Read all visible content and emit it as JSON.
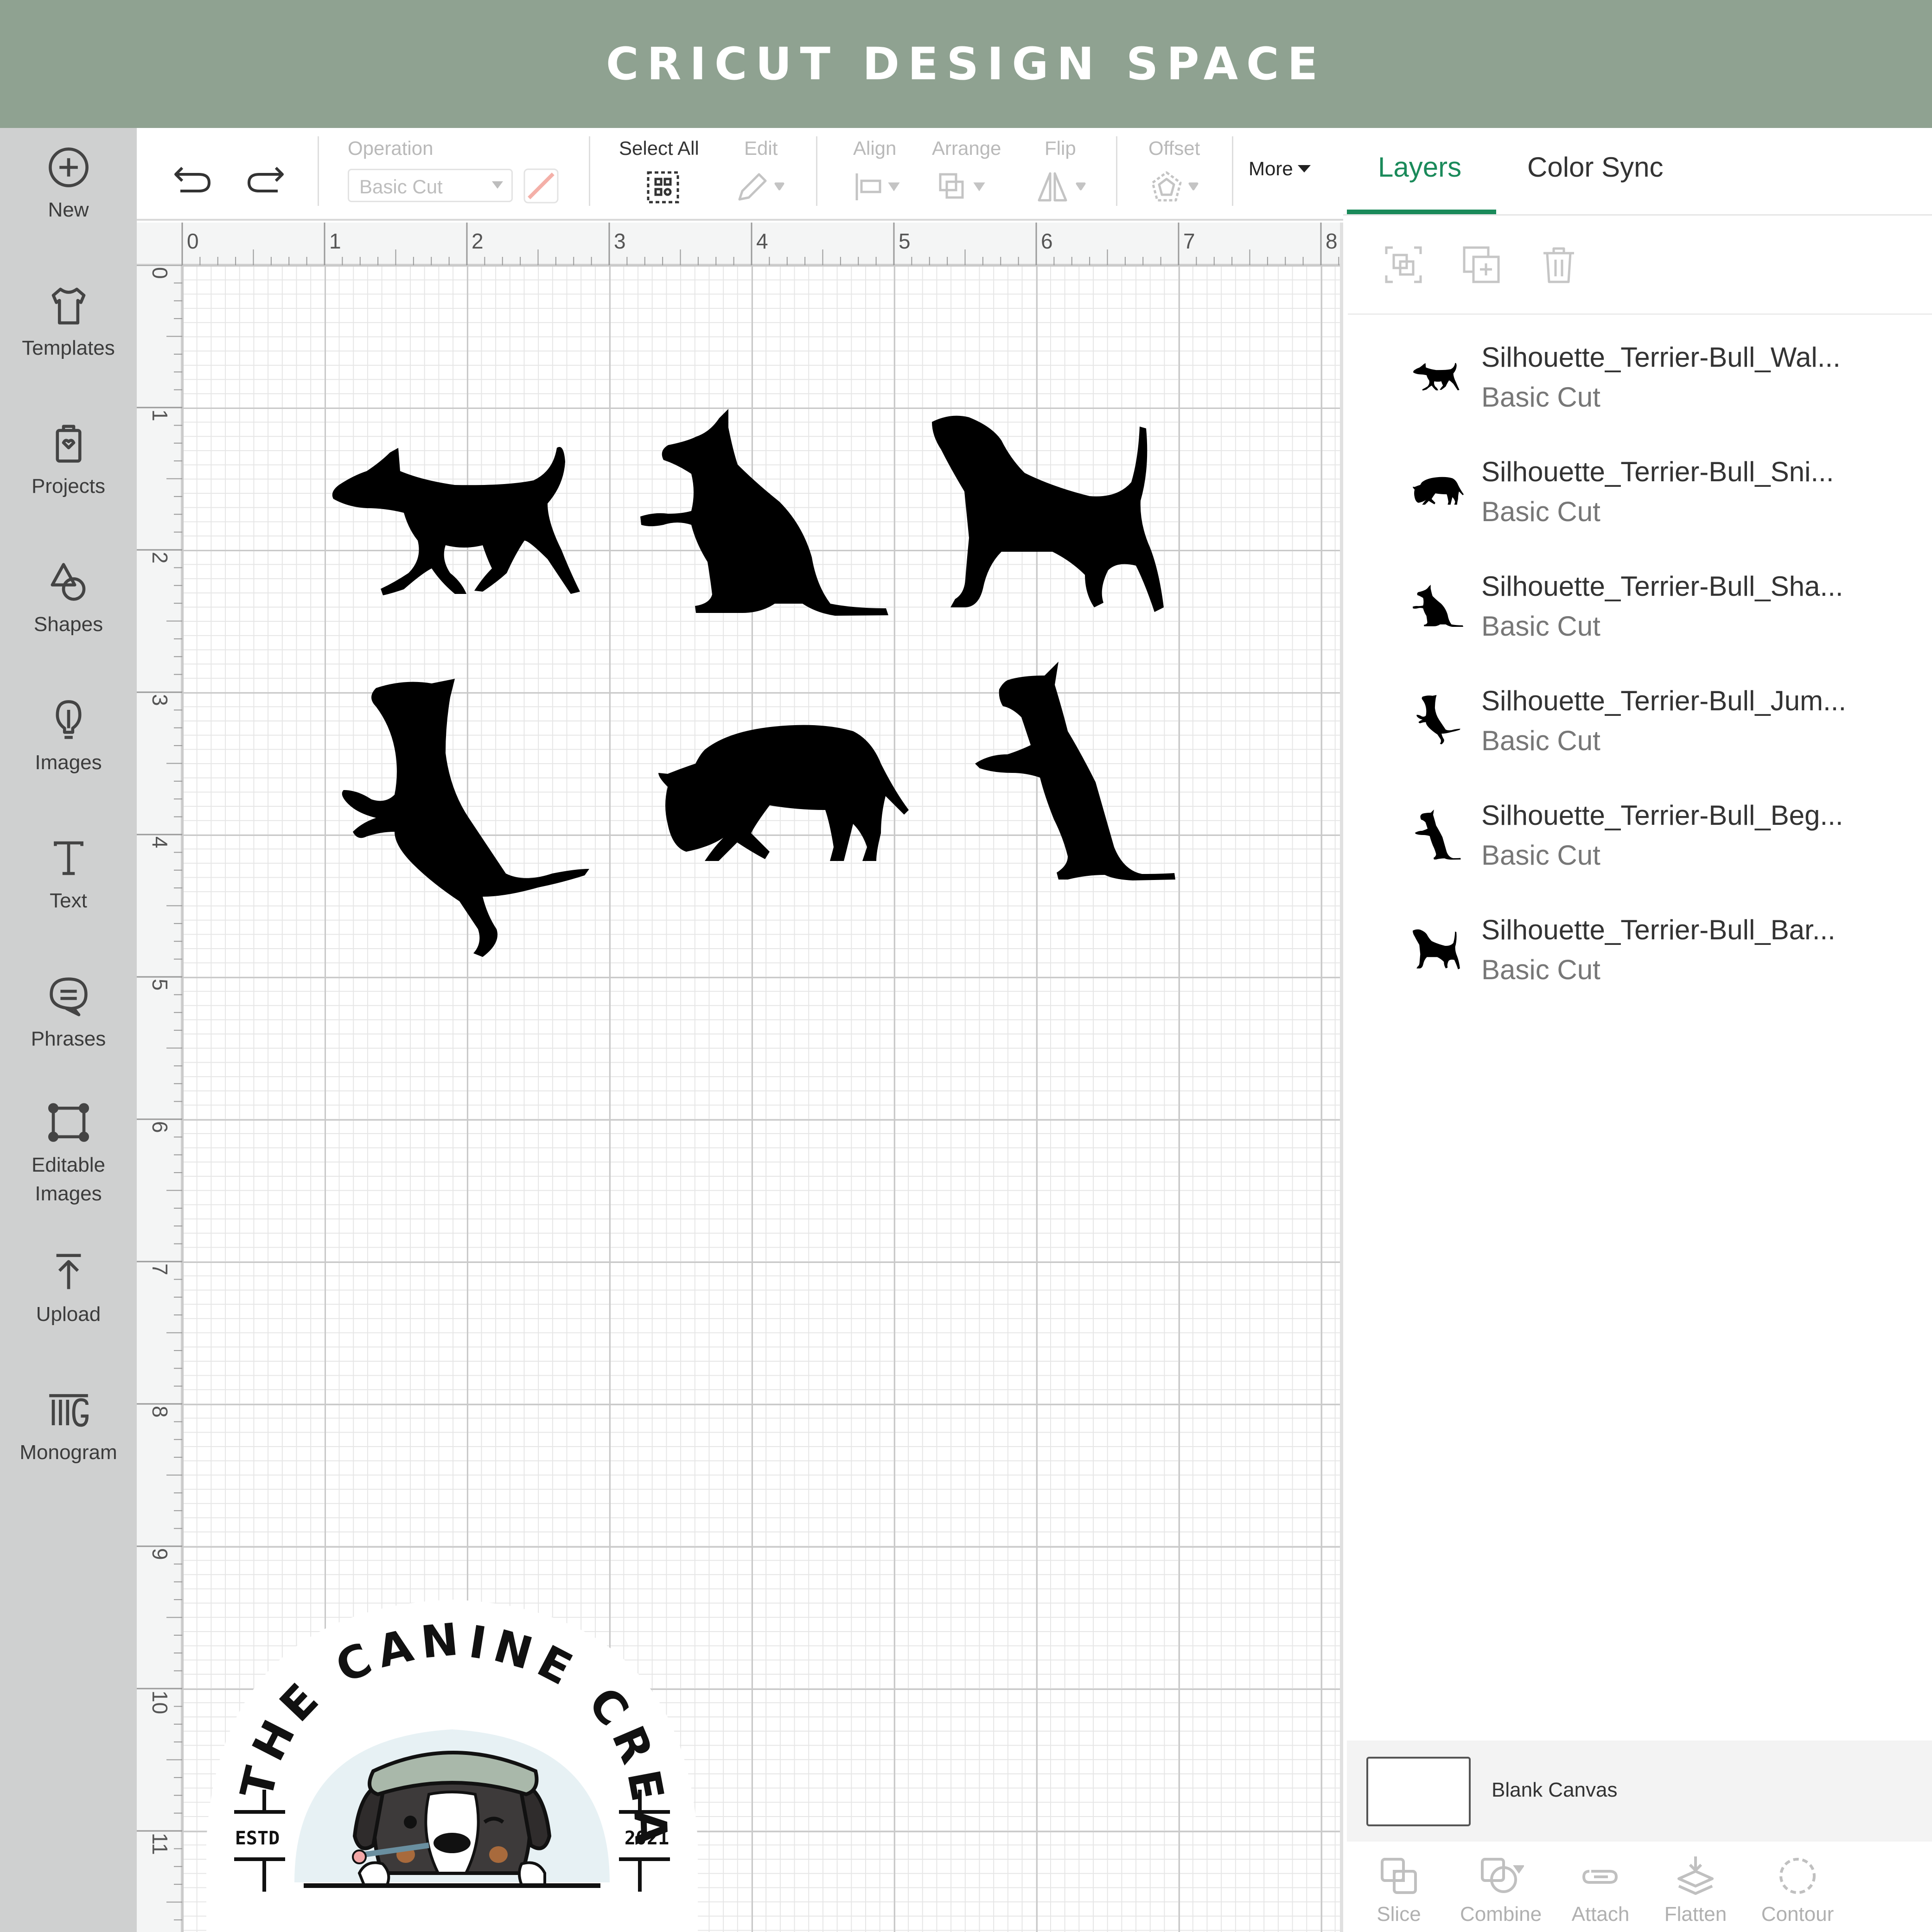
{
  "banner": {
    "title": "CRICUT DESIGN SPACE"
  },
  "sidebar": {
    "items": [
      {
        "label": "New",
        "icon": "plus-circle-icon"
      },
      {
        "label": "Templates",
        "icon": "shirt-icon"
      },
      {
        "label": "Projects",
        "icon": "projects-icon"
      },
      {
        "label": "Shapes",
        "icon": "shapes-icon"
      },
      {
        "label": "Images",
        "icon": "lightbulb-icon"
      },
      {
        "label": "Text",
        "icon": "text-icon"
      },
      {
        "label": "Phrases",
        "icon": "speech-bubble-icon"
      },
      {
        "label": "Editable Images",
        "icon": "editable-images-icon"
      },
      {
        "label": "Upload",
        "icon": "upload-icon"
      },
      {
        "label": "Monogram",
        "icon": "monogram-icon"
      }
    ]
  },
  "toolbar": {
    "operation_label": "Operation",
    "operation_value": "Basic Cut",
    "select_all_label": "Select All",
    "edit_label": "Edit",
    "align_label": "Align",
    "arrange_label": "Arrange",
    "flip_label": "Flip",
    "offset_label": "Offset",
    "more_label": "More"
  },
  "rulers": {
    "top": [
      "0",
      "1",
      "2",
      "3",
      "4",
      "5",
      "6",
      "7",
      "8"
    ],
    "left": [
      "0",
      "1",
      "2",
      "3",
      "4",
      "5",
      "6",
      "7",
      "8",
      "9",
      "10",
      "11"
    ]
  },
  "panel": {
    "tabs": [
      {
        "label": "Layers",
        "active": true
      },
      {
        "label": "Color Sync",
        "active": false
      }
    ],
    "layers": [
      {
        "name": "Silhouette_Terrier-Bull_Wal...",
        "operation": "Basic Cut"
      },
      {
        "name": "Silhouette_Terrier-Bull_Sni...",
        "operation": "Basic Cut"
      },
      {
        "name": "Silhouette_Terrier-Bull_Sha...",
        "operation": "Basic Cut"
      },
      {
        "name": "Silhouette_Terrier-Bull_Jum...",
        "operation": "Basic Cut"
      },
      {
        "name": "Silhouette_Terrier-Bull_Beg...",
        "operation": "Basic Cut"
      },
      {
        "name": "Silhouette_Terrier-Bull_Bar...",
        "operation": "Basic Cut"
      }
    ],
    "blank_canvas_label": "Blank Canvas",
    "bottom_tools": [
      "Slice",
      "Combine",
      "Attach",
      "Flatten",
      "Contour"
    ]
  },
  "logo": {
    "arc_text": "THE CANINE CREATIVE",
    "left_text": "ESTD",
    "right_text": "2021"
  },
  "colors": {
    "banner": "#8fa291",
    "sidebar": "#cfd0d0",
    "accent": "#1a8a5a"
  }
}
